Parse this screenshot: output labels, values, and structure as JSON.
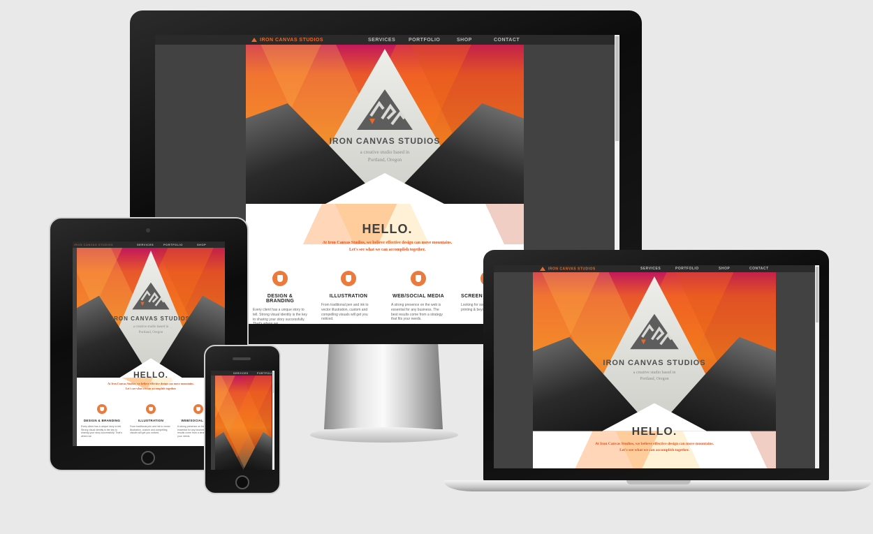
{
  "site": {
    "brand": "IRON CANVAS STUDIOS",
    "nav": [
      "SERVICES",
      "PORTFOLIO",
      "SHOP",
      "CONTACT"
    ],
    "hero_title": "IRON CANVAS STUDIOS",
    "hero_tagline_1": "a creative studio based in",
    "hero_tagline_2": "Portland, Oregon",
    "hello": "HELLO.",
    "intro_1": "At Iron Canvas Studios, we believe effective design can move mountains.",
    "intro_2": "Let's see what we can accomplish together.",
    "services": [
      {
        "name": "DESIGN & BRANDING",
        "icon": "thumbs-up-icon",
        "desc": "Every client has a unique story to tell. Strong visual identity is the key to sharing your story successfully. That's where we"
      },
      {
        "name": "ILLUSTRATION",
        "icon": "hand-icon",
        "desc": "From traditional pen and ink to vector illustration, custom and compelling visuals will get you noticed."
      },
      {
        "name": "WEB/SOCIAL MEDIA",
        "icon": "hand-icon",
        "desc": "A strong presence on the web is essential for any business. The best results come from a strategy that fits your needs."
      },
      {
        "name": "SCREEN",
        "icon": "hand-icon",
        "desc": "Looking for something special for your printing & beyond. feel the difference"
      }
    ]
  },
  "colors": {
    "accent": "#e86a2a",
    "intro_text": "#e2511d",
    "nav_bg": "#2a2a2a",
    "page_bg": "#424242"
  }
}
